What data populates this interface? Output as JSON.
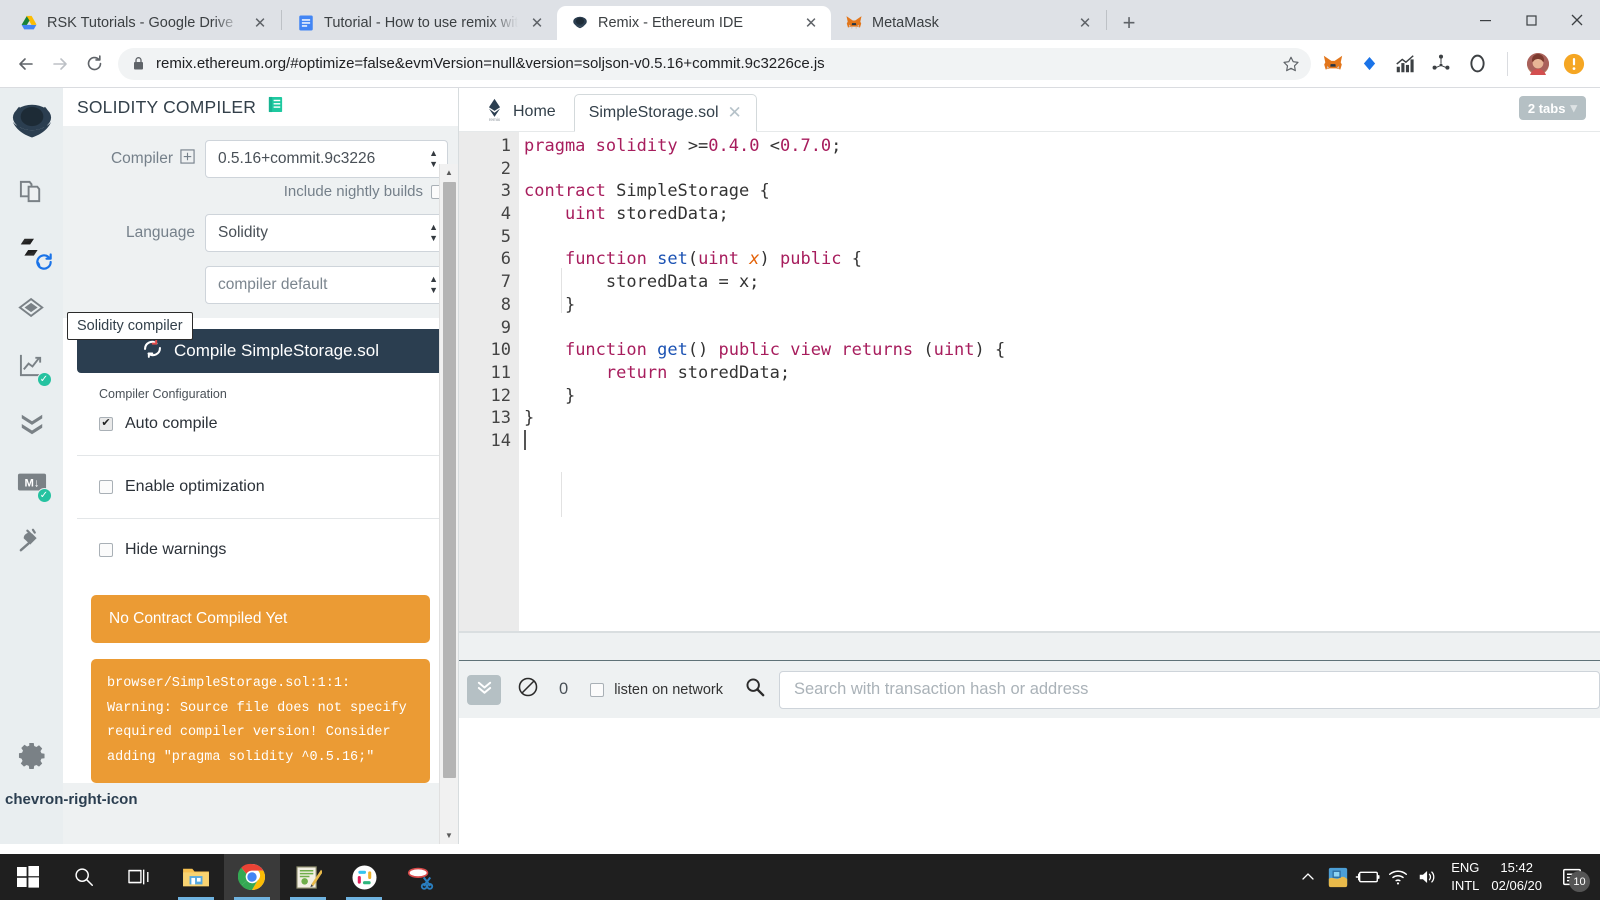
{
  "browser": {
    "tabs": [
      {
        "title": "RSK Tutorials - Google Drive",
        "favicon": "google-drive-icon",
        "active": false
      },
      {
        "title": "Tutorial - How to use remix with R",
        "favicon": "google-docs-icon",
        "active": false
      },
      {
        "title": "Remix - Ethereum IDE",
        "favicon": "remix-icon",
        "active": true
      },
      {
        "title": "MetaMask",
        "favicon": "metamask-fox-icon",
        "active": false
      }
    ],
    "new_tab_label": "+",
    "close_label": "✕",
    "window_controls": {
      "minimize": "—",
      "maximize": "❐",
      "close": "✕"
    },
    "nav": {
      "back": "←",
      "forward": "→",
      "reload": "⟳"
    },
    "url": "remix.ethereum.org/#optimize=false&evmVersion=null&version=soljson-v0.5.16+commit.9c3226ce.js",
    "lock_icon": "lock-icon",
    "star_icon": "star-icon",
    "extensions": [
      "metamask-fox-icon",
      "blue-diamond-icon",
      "chart-bars-icon",
      "dots-network-icon",
      "circle-o-icon"
    ],
    "profile_icon": "user-avatar",
    "menu_icon": "orange-alert-icon"
  },
  "rail": {
    "logo": "remix-logo-icon",
    "items": [
      {
        "name": "file-explorers-icon",
        "badge": null
      },
      {
        "name": "solidity-compiler-icon",
        "badge": null
      },
      {
        "name": "deploy-run-icon",
        "badge": null
      },
      {
        "name": "analysis-icon",
        "badge": "✓"
      },
      {
        "name": "debugger-icon",
        "badge": null
      },
      {
        "name": "markdown-docgen-icon",
        "badge": "✓"
      },
      {
        "name": "plugin-manager-icon",
        "badge": null
      }
    ],
    "settings": "gear-icon"
  },
  "sidebar": {
    "title": "SOLIDITY COMPILER",
    "title_icon": "book-icon",
    "compiler": {
      "label": "Compiler",
      "plus_icon": "plus-box-icon",
      "value": "0.5.16+commit.9c3226",
      "nightly_label": "Include nightly builds",
      "nightly_checked": false
    },
    "language": {
      "label": "Language",
      "value": "Solidity"
    },
    "evm": {
      "label": "",
      "value": "compiler default"
    },
    "tooltip": "Solidity compiler",
    "compile_button": {
      "label": "Compile SimpleStorage.sol",
      "icon": "refresh-icon"
    },
    "config_caption": "Compiler Configuration",
    "options": [
      {
        "label": "Auto compile",
        "checked": true
      },
      {
        "label": "Enable optimization",
        "checked": false
      },
      {
        "label": "Hide warnings",
        "checked": false
      }
    ],
    "no_contract_alert": "No Contract Compiled Yet",
    "warning_text": "browser/SimpleStorage.sol:1:1: Warning: Source file does not specify required compiler version! Consider adding \"pragma solidity ^0.5.16;\""
  },
  "editor": {
    "tabs": [
      {
        "label": "Home",
        "icon": "remix-home-icon",
        "active": false,
        "closable": false
      },
      {
        "label": "SimpleStorage.sol",
        "icon": null,
        "active": true,
        "closable": true
      }
    ],
    "close_label": "✕",
    "tabs_badge": "2 tabs",
    "tabs_badge_caret": "▾",
    "line_numbers": [
      1,
      2,
      3,
      4,
      5,
      6,
      7,
      8,
      9,
      10,
      11,
      12,
      13,
      14
    ],
    "fold_lines": [
      3,
      6,
      10
    ],
    "code_lines": [
      "pragma solidity >=0.4.0 <0.7.0;",
      "",
      "contract SimpleStorage {",
      "    uint storedData;",
      "",
      "    function set(uint x) public {",
      "        storedData = x;",
      "    }",
      "",
      "    function get() public view returns (uint) {",
      "        return storedData;",
      "    }",
      "}",
      ""
    ]
  },
  "terminal": {
    "toggle_icon": "chevron-double-down-icon",
    "clear_icon": "ban-circle-icon",
    "count": "0",
    "listen_label": "listen on network",
    "listen_checked": false,
    "search_icon": "magnifier-icon",
    "search_placeholder": "Search with transaction hash or address",
    "expand_icon": "chevron-right-icon"
  },
  "taskbar": {
    "start": "windows-logo-icon",
    "items": [
      {
        "name": "search-icon",
        "active": false,
        "running": false
      },
      {
        "name": "task-view-icon",
        "active": false,
        "running": false
      },
      {
        "name": "file-explorer-icon",
        "active": false,
        "running": true
      },
      {
        "name": "google-chrome-icon",
        "active": true,
        "running": true
      },
      {
        "name": "notepad-editor-icon",
        "active": false,
        "running": true
      },
      {
        "name": "slack-icon",
        "active": false,
        "running": true
      },
      {
        "name": "snipping-tool-icon",
        "active": false,
        "running": false
      }
    ],
    "tray": {
      "chevron": "^",
      "icons": [
        "intel-graphics-icon",
        "battery-charging-icon",
        "wifi-icon",
        "volume-icon"
      ],
      "language": "ENG",
      "layout": "INTL",
      "time": "15:42",
      "date": "02/06/20",
      "notification_icon": "action-center-icon",
      "notification_count": "10"
    }
  },
  "colors": {
    "accent_orange": "#eb9b34",
    "compile_navy": "#2b3e50",
    "panel_bg": "#eef1f2",
    "rail_bg": "#e9eef0",
    "badge_green": "#25c2a0",
    "keyword": "#a71d5d",
    "function": "#1b52b3",
    "param": "#e36209"
  }
}
